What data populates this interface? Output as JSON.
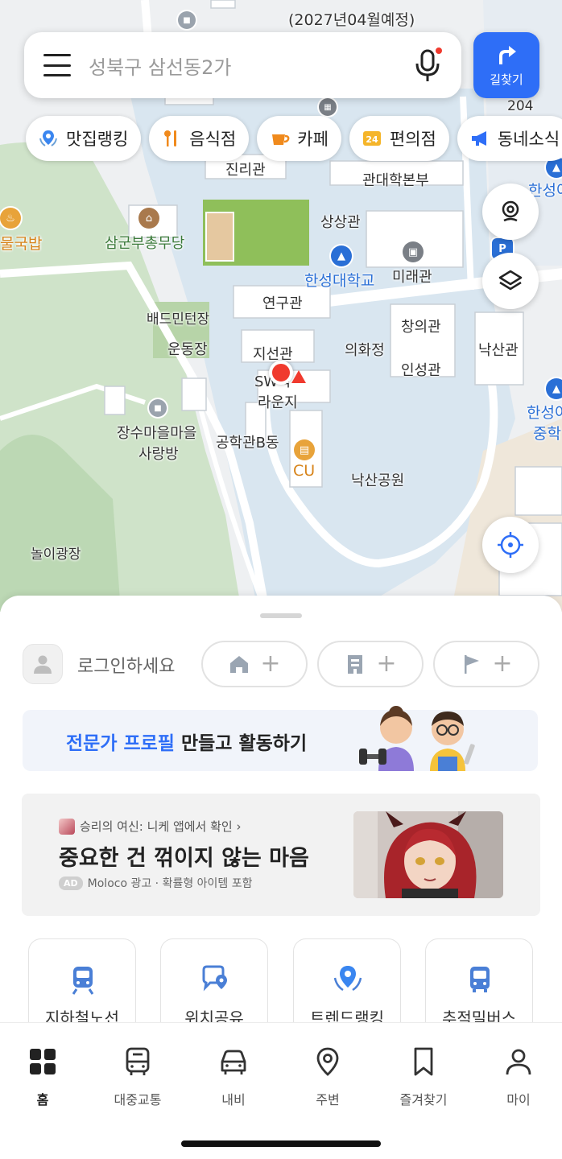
{
  "search": {
    "placeholder": "성북구 삼선동2가"
  },
  "route_button": {
    "label": "길찾기"
  },
  "chips": [
    {
      "label": "맛집랭킹",
      "icon": "pin-laurel-icon"
    },
    {
      "label": "음식점",
      "icon": "fork-knife-icon"
    },
    {
      "label": "카페",
      "icon": "cup-icon"
    },
    {
      "label": "편의점",
      "icon": "24-icon"
    },
    {
      "label": "동네소식",
      "icon": "megaphone-icon"
    }
  ],
  "map_labels": {
    "top_note": "(2027년04월예정)",
    "jinrigwan": "진리관",
    "hakbonbu": "관대학본부",
    "hansung_school": "한성여",
    "samgun": "삼군부총무당",
    "sangsang": "상상관",
    "hansung_univ": "한성대학교",
    "miraegwan": "미래관",
    "bangmin": "배드민턴장",
    "yeongu": "연구관",
    "changui": "창의관",
    "undong": "운동장",
    "jiseon": "지선관",
    "uihwa": "의화정",
    "naksan_hall": "낙산관",
    "insung": "인성관",
    "sw": "SW학",
    "lounge": "라운지",
    "jangsu1": "장수마을마을",
    "jangsu2": "사랑방",
    "gonghak": "공학관B동",
    "cu": "CU",
    "naksan_park": "낙산공원",
    "nori": "놀이광장",
    "mulguk": "물국밥",
    "hansung_mid": "한성여",
    "hansung_mid2": "중학",
    "bus_num": "204"
  },
  "sheet": {
    "login_text": "로그인하세요",
    "expert_highlight": "전문가 프로필",
    "expert_rest": " 만들고 활동하기",
    "ad": {
      "source": "승리의 여신: 니케 앱에서 확인 ›",
      "title": "중요한 건 꺾이지 않는 마음",
      "badge": "AD",
      "meta": "Moloco 광고 · 확률형 아이템 포함"
    },
    "tiles": [
      {
        "label": "지하철노선",
        "icon": "subway-icon"
      },
      {
        "label": "위치공유",
        "icon": "location-share-icon"
      },
      {
        "label": "트렌드랭킹",
        "icon": "trend-pin-icon"
      },
      {
        "label": "추적밀버스",
        "icon": "bus-icon"
      }
    ]
  },
  "tabs": [
    {
      "label": "홈",
      "active": true
    },
    {
      "label": "대중교통"
    },
    {
      "label": "내비"
    },
    {
      "label": "주변"
    },
    {
      "label": "즐겨찾기"
    },
    {
      "label": "마이"
    }
  ],
  "colors": {
    "accent": "#2e6ef7",
    "location_dot": "#f03a2e"
  }
}
